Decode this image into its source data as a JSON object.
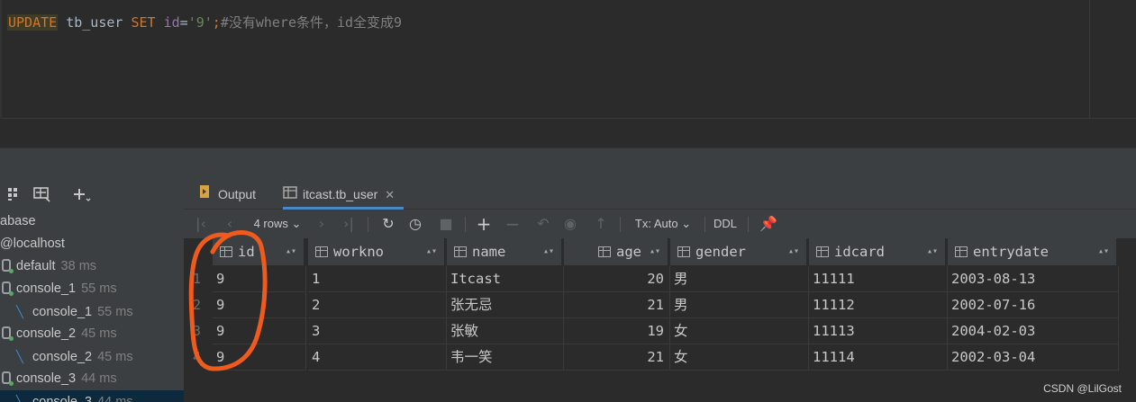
{
  "editor": {
    "sql_update": "UPDATE",
    "sql_table": " tb_user ",
    "sql_set": "SET",
    "sql_col": " id",
    "sql_eq": "=",
    "sql_val": "'9'",
    "sql_semi": ";",
    "sql_comment": "#没有where条件，id全变成9"
  },
  "db_panel": {
    "items": [
      {
        "label": "abase",
        "time": ""
      },
      {
        "label": "@localhost",
        "time": ""
      },
      {
        "label": "default",
        "time": "38 ms"
      },
      {
        "label": "console_1",
        "time": "55 ms"
      },
      {
        "label": "console_1",
        "time": "55 ms"
      },
      {
        "label": "console_2",
        "time": "45 ms"
      },
      {
        "label": "console_2",
        "time": "45 ms"
      },
      {
        "label": "console_3",
        "time": "44 ms"
      },
      {
        "label": "console_3",
        "time": "44 ms"
      }
    ]
  },
  "tabs": {
    "output": "Output",
    "table": "itcast.tb_user"
  },
  "toolbar": {
    "rows": "4 rows",
    "tx": "Tx: Auto",
    "ddl": "DDL"
  },
  "grid": {
    "columns": [
      "id",
      "workno",
      "name",
      "age",
      "gender",
      "idcard",
      "entrydate"
    ],
    "rows": [
      {
        "n": "1",
        "id": "9",
        "workno": "1",
        "name": "Itcast",
        "age": "20",
        "gender": "男",
        "idcard": "11111",
        "entrydate": "2003-08-13"
      },
      {
        "n": "2",
        "id": "9",
        "workno": "2",
        "name": "张无忌",
        "age": "21",
        "gender": "男",
        "idcard": "11112",
        "entrydate": "2002-07-16"
      },
      {
        "n": "3",
        "id": "9",
        "workno": "3",
        "name": "张敏",
        "age": "19",
        "gender": "女",
        "idcard": "11113",
        "entrydate": "2004-02-03"
      },
      {
        "n": "4",
        "id": "9",
        "workno": "4",
        "name": "韦一笑",
        "age": "21",
        "gender": "女",
        "idcard": "11114",
        "entrydate": "2002-03-04"
      }
    ]
  },
  "watermark": "CSDN @LilGost",
  "colors": {
    "annotation": "#f05a1c",
    "keyword": "#cc7832",
    "string": "#6a8759",
    "comment": "#808080"
  }
}
